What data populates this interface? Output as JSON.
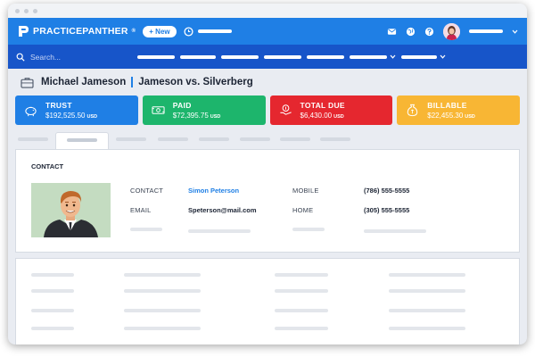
{
  "app": {
    "brand": "PRACTICEPANTHER",
    "brand_mark": "®",
    "new_button": "+ New"
  },
  "search": {
    "placeholder": "Search..."
  },
  "header": {
    "client_name": "Michael Jameson",
    "matter_name": "Jameson vs. Silverberg"
  },
  "summary_cards": [
    {
      "title": "TRUST",
      "amount": "$192,525.50",
      "currency": "USD",
      "color": "#1f7fe5",
      "icon": "piggy-bank-icon"
    },
    {
      "title": "PAID",
      "amount": "$72,395.75",
      "currency": "USD",
      "color": "#1db56c",
      "icon": "cash-icon"
    },
    {
      "title": "TOTAL DUE",
      "amount": "$6,430.00",
      "currency": "USD",
      "color": "#e5272f",
      "icon": "hand-coin-icon"
    },
    {
      "title": "BILLABLE",
      "amount": "$22,455.30",
      "currency": "USD",
      "color": "#f8b634",
      "icon": "money-bag-icon"
    }
  ],
  "contact": {
    "heading": "CONTACT",
    "contact_label": "CONTACT",
    "contact_value": "Simon Peterson",
    "email_label": "EMAIL",
    "email_value": "Speterson@mail.com",
    "mobile_label": "MOBILE",
    "mobile_value": "(786) 555-5555",
    "home_label": "HOME",
    "home_value": "(305) 555-5555"
  },
  "colors": {
    "topbar": "#1f7fe5",
    "searchbar": "#1755c9",
    "background": "#e9ecf2"
  }
}
